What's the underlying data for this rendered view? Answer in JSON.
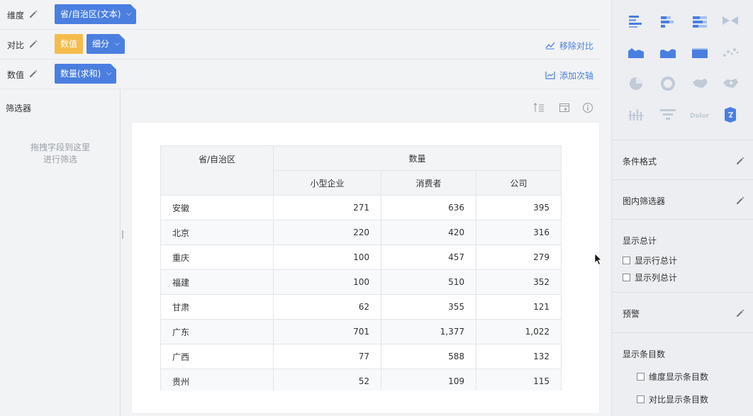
{
  "rows": {
    "dimension": {
      "label": "维度",
      "pill": "省/自治区(文本)"
    },
    "compare": {
      "label": "对比",
      "pill_value": "数值",
      "pill_detail": "细分",
      "action": "移除对比"
    },
    "value": {
      "label": "数值",
      "pill": "数量(求和)",
      "action": "添加次轴"
    }
  },
  "filter": {
    "title": "筛选器",
    "hint_line1": "拖拽字段到这里",
    "hint_line2": "进行筛选"
  },
  "table": {
    "header_row_label": "省/自治区",
    "header_group": "数量",
    "columns": [
      "小型企业",
      "消费者",
      "公司"
    ],
    "rows": [
      {
        "name": "安徽",
        "values": [
          "271",
          "636",
          "395"
        ]
      },
      {
        "name": "北京",
        "values": [
          "220",
          "420",
          "316"
        ]
      },
      {
        "name": "重庆",
        "values": [
          "100",
          "457",
          "279"
        ]
      },
      {
        "name": "福建",
        "values": [
          "100",
          "510",
          "352"
        ]
      },
      {
        "name": "甘肃",
        "values": [
          "62",
          "355",
          "121"
        ]
      },
      {
        "name": "广东",
        "values": [
          "701",
          "1,377",
          "1,022"
        ]
      },
      {
        "name": "广西",
        "values": [
          "77",
          "588",
          "132"
        ]
      },
      {
        "name": "贵州",
        "values": [
          "52",
          "109",
          "115"
        ]
      }
    ]
  },
  "right_panel": {
    "conditional_format": "条件格式",
    "chart_filter": "图内筛选器",
    "show_total": "显示总计",
    "show_row_total": "显示行总计",
    "show_col_total": "显示列总计",
    "alert": "预警",
    "show_count": "显示条目数",
    "dim_show_count": "维度显示条目数",
    "cmp_show_count": "对比显示条目数",
    "wordcloud_text": "Dolor"
  },
  "colors": {
    "accent": "#4a7fe0",
    "value_pill": "#f5bc4d",
    "icon_blue": "#4a7fe0"
  }
}
